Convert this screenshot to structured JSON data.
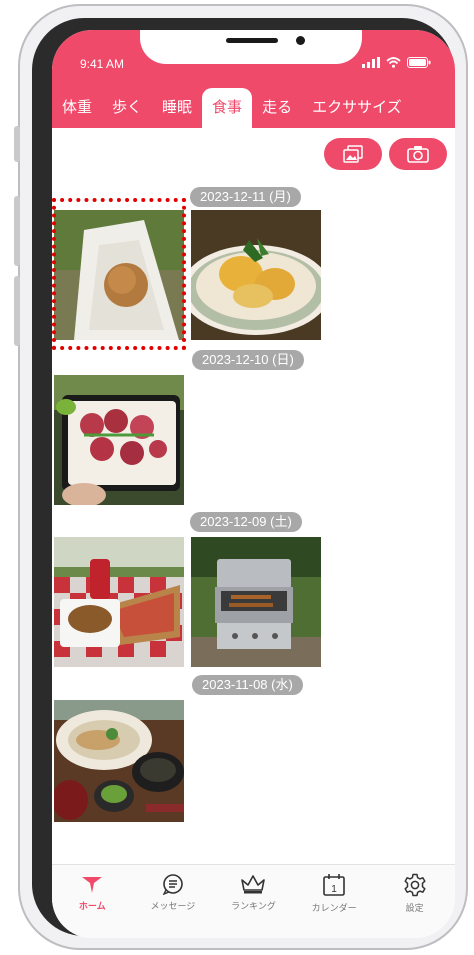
{
  "status": {
    "time": "9:41 AM"
  },
  "tabs": [
    {
      "label": "体重"
    },
    {
      "label": "歩く"
    },
    {
      "label": "睡眠"
    },
    {
      "label": "食事"
    },
    {
      "label": "走る"
    },
    {
      "label": "エクササイズ"
    }
  ],
  "dates": [
    {
      "label": "2023-12-11 (月)"
    },
    {
      "label": "2023-12-10 (日)"
    },
    {
      "label": "2023-12-09 (土)"
    },
    {
      "label": "2023-11-08 (水)"
    }
  ],
  "nav": [
    {
      "label": "ホーム",
      "icon": "home-icon"
    },
    {
      "label": "メッセージ",
      "icon": "message-icon"
    },
    {
      "label": "ランキング",
      "icon": "crown-icon"
    },
    {
      "label": "カレンダー",
      "icon": "calendar-icon"
    },
    {
      "label": "設定",
      "icon": "gear-icon"
    }
  ],
  "calendar_day": "1",
  "colors": {
    "accent": "#f04a6b",
    "badge": "#a8a8a8",
    "highlight": "#e30000"
  }
}
